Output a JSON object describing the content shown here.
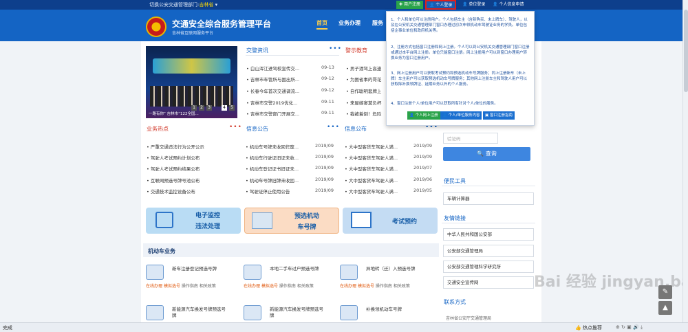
{
  "topbar": {
    "dept_label": "切换公安交通管理部门:",
    "dept_value": "吉林省",
    "register": "用户注册",
    "login": "个人登录",
    "unit_login": "单位登录",
    "info_apply": "个人信息申请"
  },
  "header": {
    "title": "交通安全综合服务管理平台",
    "subtitle": "吉林省互联网服务平台",
    "nav": [
      "首页",
      "业务办理",
      "服务"
    ]
  },
  "news": {
    "title": "交警资讯",
    "more": "•••",
    "image_caption": "一路有你”  吉林市“122全国...",
    "pages": [
      "1",
      "2",
      "3",
      "4",
      "5"
    ],
    "items": [
      {
        "t": "白山浑江进驾校宣传交...",
        "d": "09-13"
      },
      {
        "t": "吉林市车管所与国出所...",
        "d": "09-12"
      },
      {
        "t": "长春今年首次交通调流...",
        "d": "09-12"
      },
      {
        "t": "吉林市交警2019优化...",
        "d": "09-11"
      },
      {
        "t": "吉林市交警部门开展交...",
        "d": "09-11"
      }
    ]
  },
  "warning": {
    "title": "警示教育",
    "items": [
      "男子酒驾上高速",
      "为图省事的哥花",
      "自作聪明套牌上",
      "来屋嫁宴莫负杯",
      "我被着倒！危险"
    ]
  },
  "hot": {
    "title": "业务热点",
    "items": [
      "严重交通违法行为公开公示",
      "驾驶人考试预约计划公布",
      "驾驶人考试预约结果公布",
      "互联网预选号牌号池公布",
      "交通技术监控设备公布"
    ]
  },
  "notice": {
    "title": "信息公告",
    "items": [
      {
        "t": "机动车号牌未收回作废...",
        "d": "2019/09"
      },
      {
        "t": "机动车行驶证旧证未收...",
        "d": "2019/09"
      },
      {
        "t": "机动车登记证书旧证未...",
        "d": "2019/09"
      },
      {
        "t": "机动车号牌旧牌未收回...",
        "d": "2019/09"
      },
      {
        "t": "驾驶证停止使用公告",
        "d": "2019/09"
      }
    ]
  },
  "publish": {
    "title": "信息公布",
    "items": [
      {
        "t": "大中型客货车驾驶人满...",
        "d": "2019/09"
      },
      {
        "t": "大中型客货车驾驶人满...",
        "d": "2019/09"
      },
      {
        "t": "大中型客货车驾驶人满...",
        "d": "2019/07"
      },
      {
        "t": "大中型客货车驾驶人满...",
        "d": "2019/06"
      },
      {
        "t": "大中型客货车驾驶人满...",
        "d": "2019/05"
      }
    ]
  },
  "quick": [
    {
      "line1": "电子监控",
      "line2": "违法处理",
      "bg": "#b9dcf4",
      "fg": "#1a5fa8"
    },
    {
      "line1": "预选机动",
      "line2": "车号牌",
      "bg": "#fbdcc4",
      "fg": "#1a5fa8"
    },
    {
      "line1": "考试预约",
      "line2": "",
      "bg": "#c4dcf3",
      "fg": "#1a5fa8"
    }
  ],
  "vehicle": {
    "title": "机动车业务",
    "items": [
      {
        "name": "新车注册登记预选号牌",
        "ops": [
          "在线办理",
          "模拟选号",
          "操作指南",
          "相关政策"
        ]
      },
      {
        "name": "本地二手车过户预选号牌",
        "ops": [
          "在线办理",
          "模拟选号",
          "操作指南",
          "相关政策"
        ]
      },
      {
        "name": "异地转（迁）入预选号牌",
        "ops": [
          "在线办理",
          "模拟选号",
          "操作指南",
          "相关政策"
        ]
      },
      {
        "name": "新能源汽车换发号牌预选号牌",
        "ops": []
      },
      {
        "name": "新能源汽车换发号牌预选号牌",
        "ops": []
      },
      {
        "name": "补换领机动车号牌",
        "ops": []
      }
    ]
  },
  "login_panel": {
    "captcha_placeholder": "验证码",
    "query_btn": "查询"
  },
  "convenience": {
    "title": "便民工具",
    "items": [
      "车辆计算器"
    ]
  },
  "links": {
    "title": "友情链接",
    "items": [
      "中华人民共和国公安部",
      "公安部交通管理局",
      "公安部交通管理科学研究所",
      "交通安全宣传网"
    ]
  },
  "contact": {
    "title": "联系方式",
    "text": "吉林省公安厅交通管理局"
  },
  "popup": {
    "paras": [
      "1、个人和单位可以注册用户。个人包括车主（含新购买、未上牌车）、驾驶人，以及在公安机关交通管理部门窗口办理过初次申领机动车驾驶证业务的学员。单位包括企事业单位和政府机关等。",
      "2、注册方式包括窗口注册和网上注册。个人可以到公安机关交通管理部门窗口注册或通过本平台网上注册。单位只能窗口注册。网上注册用户可以到窗口办理用户转换业务为窗口注册用户。",
      "3、网上注册用户可以获取考试预约和预选机动车号牌服务；同上注册新车（未上牌）车主用户可以获取预选机动车号牌服务；其他网上注册车主和驾驶人用户可以获取除补换领牌证、延期业务以外的个人服务。",
      "4、窗口注册个人/单位用户可以获取所有针对个人/单位的服务。"
    ],
    "buttons": [
      "个人网上注册",
      "个人/单位服务内容",
      "窗口注册指南"
    ]
  },
  "status": {
    "left": "完成",
    "right": "热点推荐"
  },
  "watermark": "Bai 经验 jingyan.baidu.com"
}
